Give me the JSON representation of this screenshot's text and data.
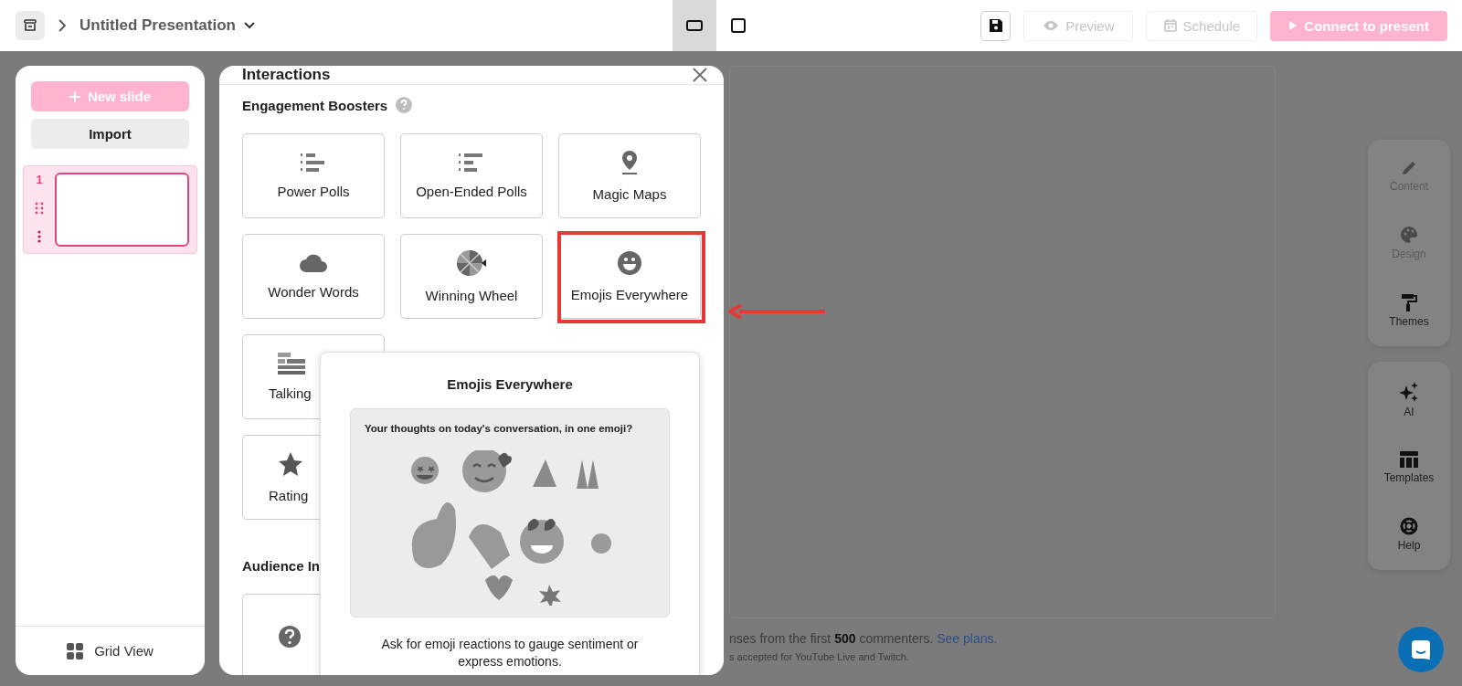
{
  "top_bar": {
    "title": "Untitled Presentation",
    "view_modes": [
      {
        "selected": true
      },
      {
        "selected": false
      }
    ],
    "buttons": [
      {
        "kind": "secondary",
        "label": "Preview",
        "disabled": true
      },
      {
        "kind": "secondary",
        "label": "Schedule",
        "disabled": true
      },
      {
        "kind": "primary",
        "label": "Connect to present",
        "disabled": true
      }
    ]
  },
  "sidebar": {
    "new_slide": "New slide",
    "import": "Import",
    "slides": [
      {
        "number": "1",
        "selected": true
      }
    ],
    "grid_view": "Grid View"
  },
  "interactions": {
    "title": "Interactions",
    "section": "Engagement Boosters",
    "cards": [
      {
        "label": "Power Polls",
        "highlighted": false,
        "cut": false
      },
      {
        "label": "Open-Ended Polls",
        "highlighted": false,
        "cut": false
      },
      {
        "label": "Magic Maps",
        "highlighted": false,
        "cut": false
      },
      {
        "label": "Wonder Words",
        "highlighted": false,
        "cut": false
      },
      {
        "label": "Winning Wheel",
        "highlighted": false,
        "cut": false
      },
      {
        "label": "Emojis Everywhere",
        "highlighted": true,
        "cut": false
      },
      {
        "label": "Talking",
        "highlighted": false,
        "cut": true
      },
      {
        "label": "Rating",
        "highlighted": false,
        "cut": true
      }
    ],
    "section_2": "Audience In",
    "cards_2": [
      {
        "cut": true
      }
    ]
  },
  "popup": {
    "title": "Emojis Everywhere",
    "question": "Your thoughts on today's conversation, in one emoji?",
    "description": "Ask for emoji reactions to gauge sentiment or express emotions."
  },
  "canvas_footer": {
    "line_1": "nses from the first **500** commenters.",
    "link": "See plans.",
    "line_2": "s accepted for YouTube Live and Twitch."
  },
  "tool_groups": [
    {
      "items": [
        {
          "label": "Content",
          "disabled": true
        },
        {
          "label": "Design",
          "disabled": true
        },
        {
          "label": "Themes",
          "disabled": false
        }
      ]
    },
    {
      "items": [
        {
          "label": "AI",
          "disabled": false
        },
        {
          "label": "Templates",
          "disabled": false
        },
        {
          "label": "Help",
          "disabled": false
        }
      ]
    }
  ]
}
